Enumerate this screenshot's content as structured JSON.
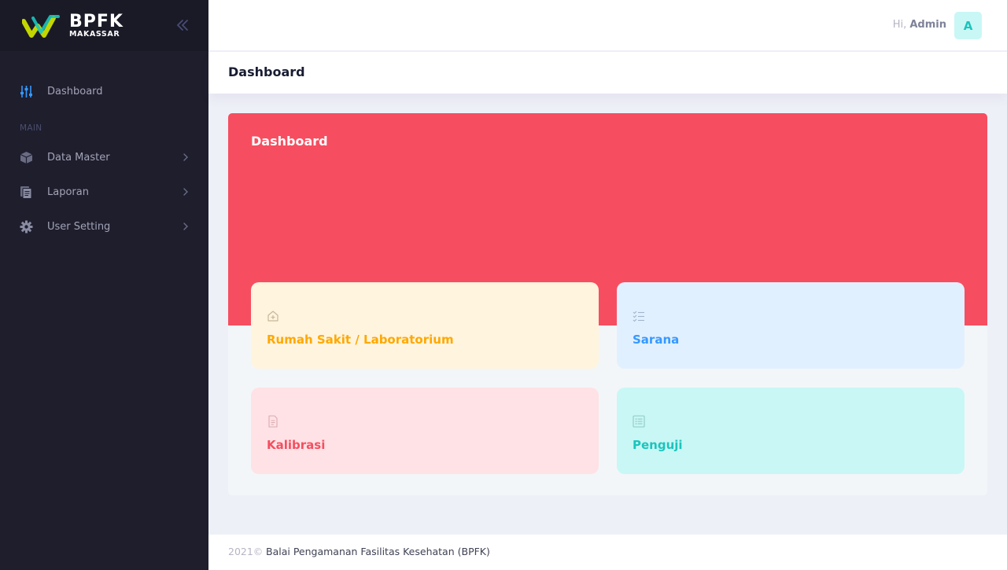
{
  "brand": {
    "name": "BPFK",
    "subname": "MAKASSAR",
    "colors": {
      "mark_green": "#c4d600",
      "mark_teal": "#1bc5bd"
    }
  },
  "sidebar": {
    "items": [
      {
        "label": "Dashboard",
        "icon": "sliders-icon",
        "active": true
      },
      {
        "label": "Data Master",
        "icon": "box-icon",
        "has_submenu": true
      },
      {
        "label": "Laporan",
        "icon": "documents-icon",
        "has_submenu": true
      },
      {
        "label": "User Setting",
        "icon": "gear-icon",
        "has_submenu": true
      }
    ],
    "section_main": "MAIN",
    "toggle_icon": "double-chevron-left-icon"
  },
  "header": {
    "greeting_prefix": "Hi,",
    "user_name": "Admin",
    "avatar_letter": "A"
  },
  "subheader": {
    "title": "Dashboard"
  },
  "main": {
    "hero_title": "Dashboard",
    "hero_color": "#f64e60",
    "tiles": [
      {
        "label": "Rumah Sakit / Laboratorium",
        "icon": "hospital-icon",
        "color": "#ffa800"
      },
      {
        "label": "Sarana",
        "icon": "checklist-icon",
        "color": "#3699ff"
      },
      {
        "label": "Kalibrasi",
        "icon": "document-icon",
        "color": "#f64e60"
      },
      {
        "label": "Penguji",
        "icon": "list-icon",
        "color": "#1bc5bd"
      }
    ]
  },
  "footer": {
    "year": "2021©",
    "org": "Balai Pengamanan Fasilitas Kesehatan (BPFK)"
  }
}
